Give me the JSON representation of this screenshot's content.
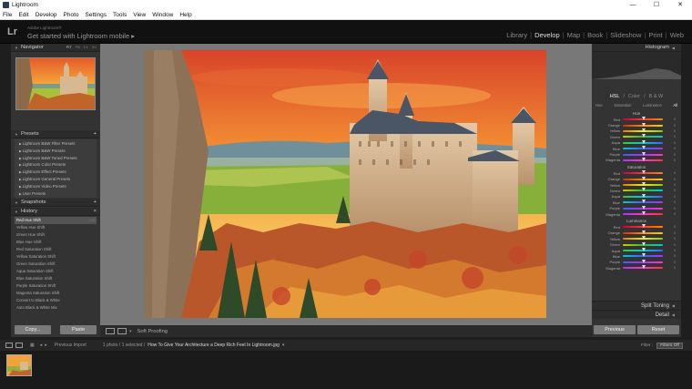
{
  "window": {
    "title": "Lightroom",
    "minimize": "—",
    "maximize": "☐",
    "close": "✕"
  },
  "menu": [
    "File",
    "Edit",
    "Develop",
    "Photo",
    "Settings",
    "Tools",
    "View",
    "Window",
    "Help"
  ],
  "identity": {
    "logo": "Lr",
    "account": "Adobe Lightroom®",
    "mobile_text": "Get started with Lightroom mobile ▸"
  },
  "modules": [
    {
      "label": "Library",
      "active": false
    },
    {
      "label": "Develop",
      "active": true
    },
    {
      "label": "Map",
      "active": false
    },
    {
      "label": "Book",
      "active": false
    },
    {
      "label": "Slideshow",
      "active": false
    },
    {
      "label": "Print",
      "active": false
    },
    {
      "label": "Web",
      "active": false
    }
  ],
  "navigator": {
    "title": "Navigator",
    "options": [
      "FIT",
      "Fill",
      "1:1",
      "3:1"
    ]
  },
  "presets": {
    "title": "Presets",
    "items": [
      "Lightroom B&W Filter Presets",
      "Lightroom B&W Presets",
      "Lightroom B&W Toned Presets",
      "Lightroom Color Presets",
      "Lightroom Effect Presets",
      "Lightroom General Presets",
      "Lightroom Video Presets",
      "User Presets"
    ]
  },
  "snapshots": {
    "title": "Snapshots"
  },
  "history": {
    "title": "History",
    "items": [
      {
        "label": "Red Hue Shift",
        "value": "+28",
        "sel": true
      },
      {
        "label": "Yellow Hue Shift",
        "value": "",
        "sel": false
      },
      {
        "label": "Green Hue Shift",
        "value": "",
        "sel": false
      },
      {
        "label": "Blue Hue Shift",
        "value": "",
        "sel": false
      },
      {
        "label": "Red Saturation Shift",
        "value": "",
        "sel": false
      },
      {
        "label": "Yellow Saturation Shift",
        "value": "",
        "sel": false
      },
      {
        "label": "Green Saturation Shift",
        "value": "",
        "sel": false
      },
      {
        "label": "Aqua Saturation Shift",
        "value": "",
        "sel": false
      },
      {
        "label": "Blue Saturation Shift",
        "value": "",
        "sel": false
      },
      {
        "label": "Purple Saturation Shift",
        "value": "",
        "sel": false
      },
      {
        "label": "Magenta Saturation Shift",
        "value": "",
        "sel": false
      },
      {
        "label": "Convert to Black & White",
        "value": "",
        "sel": false
      },
      {
        "label": "Auto Black & White Mix",
        "value": "",
        "sel": false
      }
    ]
  },
  "left_buttons": {
    "copy": "Copy...",
    "paste": "Paste"
  },
  "toolbar": {
    "soft_proofing": "Soft Proofing"
  },
  "right": {
    "histogram": "Histogram",
    "hsl_header": [
      "HSL",
      "/",
      "Color",
      "/",
      "B & W"
    ],
    "tabs": [
      "Hue",
      "Saturation",
      "Luminance",
      "All"
    ],
    "sections": [
      {
        "title": "Hue"
      },
      {
        "title": "Saturation"
      },
      {
        "title": "Luminance"
      }
    ],
    "colors": [
      {
        "name": "Red",
        "grad": "linear-gradient(90deg,#c04,#f33,#f80)"
      },
      {
        "name": "Orange",
        "grad": "linear-gradient(90deg,#c30,#f80,#fc0)"
      },
      {
        "name": "Yellow",
        "grad": "linear-gradient(90deg,#e70,#ee0,#8c0)"
      },
      {
        "name": "Green",
        "grad": "linear-gradient(90deg,#cc0,#3b3,#0cc)"
      },
      {
        "name": "Aqua",
        "grad": "linear-gradient(90deg,#3c3,#0cc,#36f)"
      },
      {
        "name": "Blue",
        "grad": "linear-gradient(90deg,#0cc,#36f,#a3f)"
      },
      {
        "name": "Purple",
        "grad": "linear-gradient(90deg,#36f,#a3f,#f3c)"
      },
      {
        "name": "Magenta",
        "grad": "linear-gradient(90deg,#a3f,#f3c,#f33)"
      }
    ],
    "slider_value": "0",
    "split_toning": "Split Toning",
    "detail": "Detail",
    "previous": "Previous",
    "reset": "Reset"
  },
  "filmstrip_bar": {
    "prev_import": "Previous Import",
    "count": "1 photo / 1 selected /",
    "filename": "How To Give Your Architecture a Deep Rich Feel In Lightroom.jpg",
    "filter_label": "Filter :",
    "filter_value": "Filters Off"
  }
}
